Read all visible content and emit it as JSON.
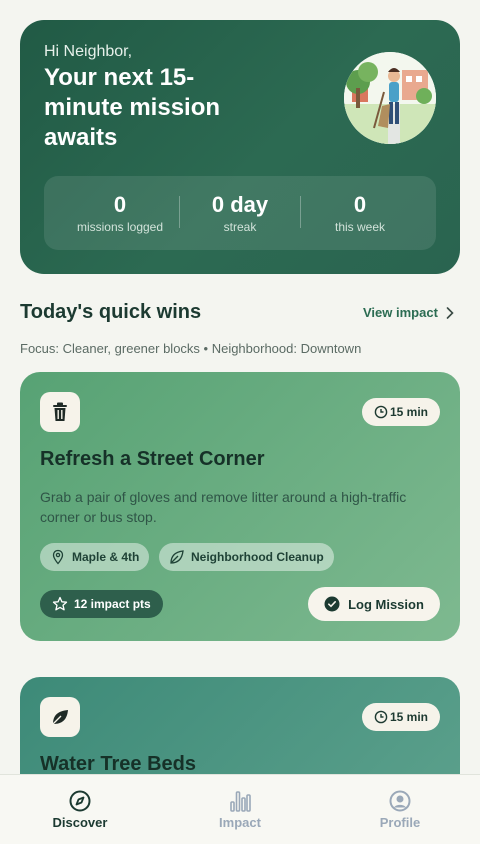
{
  "hero": {
    "greeting": "Hi Neighbor,",
    "title": "Your next 15-minute mission awaits",
    "stats": [
      {
        "value": "0",
        "label": "missions logged"
      },
      {
        "value": "0 day",
        "label": "streak"
      },
      {
        "value": "0",
        "label": "this week"
      }
    ]
  },
  "section": {
    "title": "Today's quick wins",
    "view_link": "View impact",
    "focus": "Focus: Cleaner, greener blocks • Neighborhood: Downtown"
  },
  "missions": [
    {
      "icon": "trash-icon",
      "duration": "15 min",
      "title": "Refresh a Street Corner",
      "description": "Grab a pair of gloves and remove litter around a high-traffic corner or bus stop.",
      "location": "Maple & 4th",
      "category": "Neighborhood Cleanup",
      "points": "12 impact pts",
      "action": "Log Mission",
      "color": "#57a274"
    },
    {
      "icon": "leaf-icon",
      "duration": "15 min",
      "title": "Water Tree Beds",
      "color": "#3d8a78"
    }
  ],
  "tabs": [
    {
      "label": "Discover",
      "icon": "compass-icon",
      "active": true
    },
    {
      "label": "Impact",
      "icon": "bar-chart-icon",
      "active": false
    },
    {
      "label": "Profile",
      "icon": "user-circle-icon",
      "active": false
    }
  ],
  "colors": {
    "primary": "#215a45",
    "accent": "#2b6c52",
    "inactive": "#9aa8b8"
  }
}
